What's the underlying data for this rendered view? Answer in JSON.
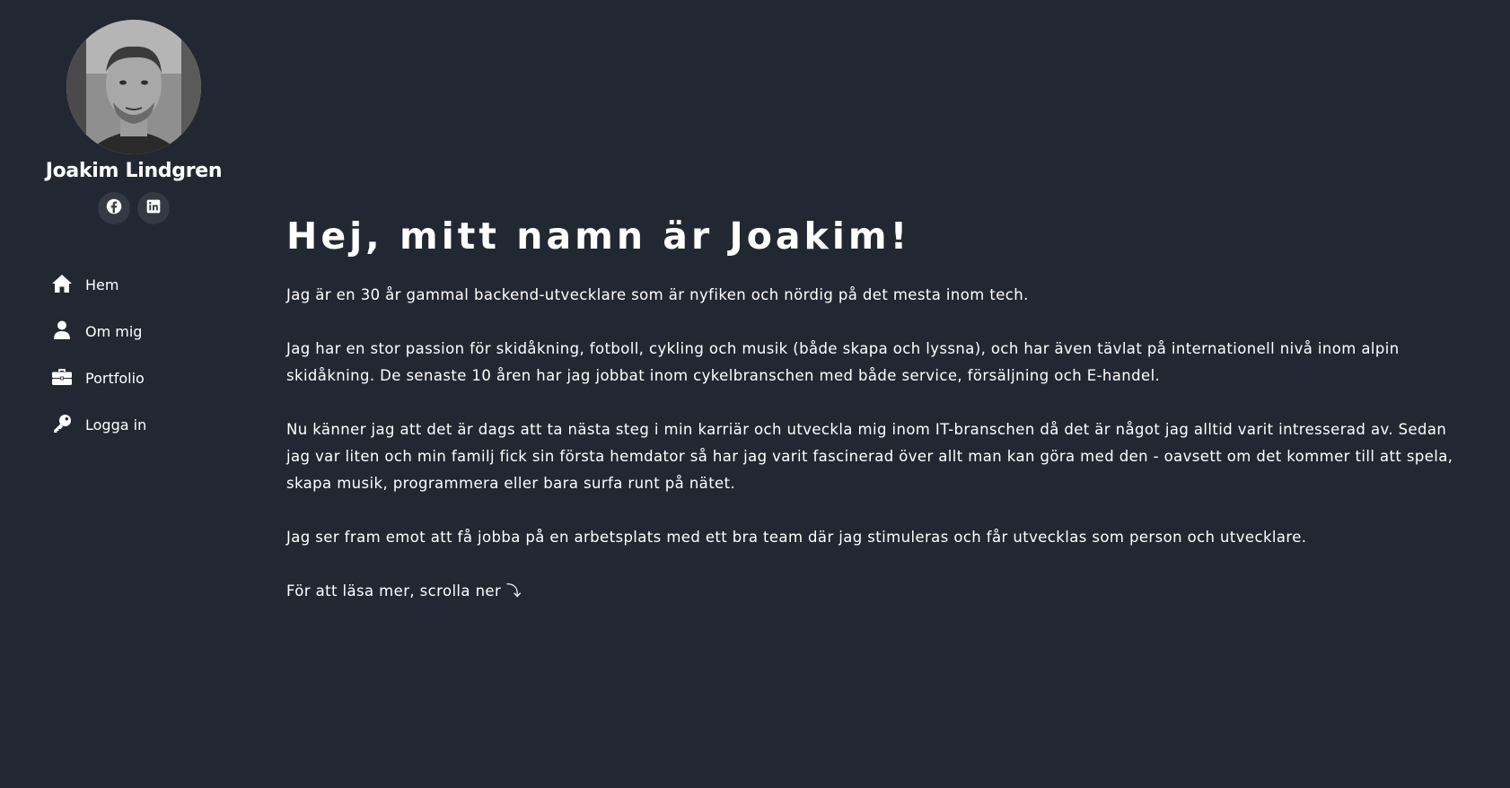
{
  "profile": {
    "name": "Joakim Lindgren"
  },
  "social": [
    {
      "icon": "facebook-icon"
    },
    {
      "icon": "linkedin-icon"
    }
  ],
  "nav": [
    {
      "label": "Hem",
      "icon": "home-icon"
    },
    {
      "label": "Om mig",
      "icon": "user-icon"
    },
    {
      "label": "Portfolio",
      "icon": "briefcase-icon"
    },
    {
      "label": "Logga in",
      "icon": "key-icon"
    }
  ],
  "main": {
    "headline": "Hej, mitt namn är Joakim!",
    "paragraphs": [
      "Jag är en 30 år gammal backend-utvecklare som är nyfiken och nördig på det mesta inom tech.",
      "Jag har en stor passion för skidåkning, fotboll, cykling och musik (både skapa och lyssna), och har även tävlat på internationell nivå inom alpin skidåkning. De senaste 10 åren har jag jobbat inom cykelbranschen med både service, försäljning och E-handel.",
      "Nu känner jag att det är dags att ta nästa steg i min karriär och utveckla mig inom IT-branschen då det är något jag alltid varit intresserad av. Sedan jag var liten och min familj fick sin första hemdator så har jag varit fascinerad över allt man kan göra med den - oavsett om det kommer till att spela, skapa musik, programmera eller bara surfa runt på nätet.",
      "Jag ser fram emot att få jobba på en arbetsplats med ett bra team där jag stimuleras och får utvecklas som person och utvecklare.",
      "För att läsa mer, scrolla ner ⤵"
    ]
  },
  "colors": {
    "background": "#222831",
    "text": "#ffffff",
    "social_button": "#343a43"
  }
}
